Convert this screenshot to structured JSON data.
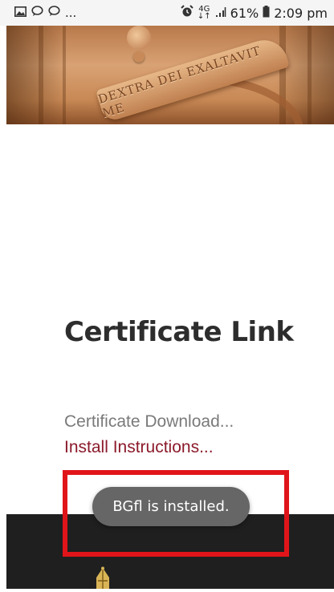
{
  "status_bar": {
    "left_icons": [
      "image-icon",
      "chat-icon",
      "chat-icon",
      "more-ellipsis"
    ],
    "ellipsis": "...",
    "network_top": "4G",
    "network_bottom": "↓↑",
    "battery_percent": "61%",
    "time": "2:09 pm"
  },
  "hero": {
    "engraving_text": "DEXTRA DEI EXALTAVIT ME"
  },
  "content": {
    "title": "Certificate Link",
    "download_link": "Certificate Download...",
    "install_link": "Install Instructions..."
  },
  "toast": {
    "message": "BGfl is installed."
  },
  "colors": {
    "install_link": "#8b1a2b",
    "highlight_border": "#e0151a",
    "footer_bg": "#1f1f1f",
    "toast_bg": "#666666"
  }
}
